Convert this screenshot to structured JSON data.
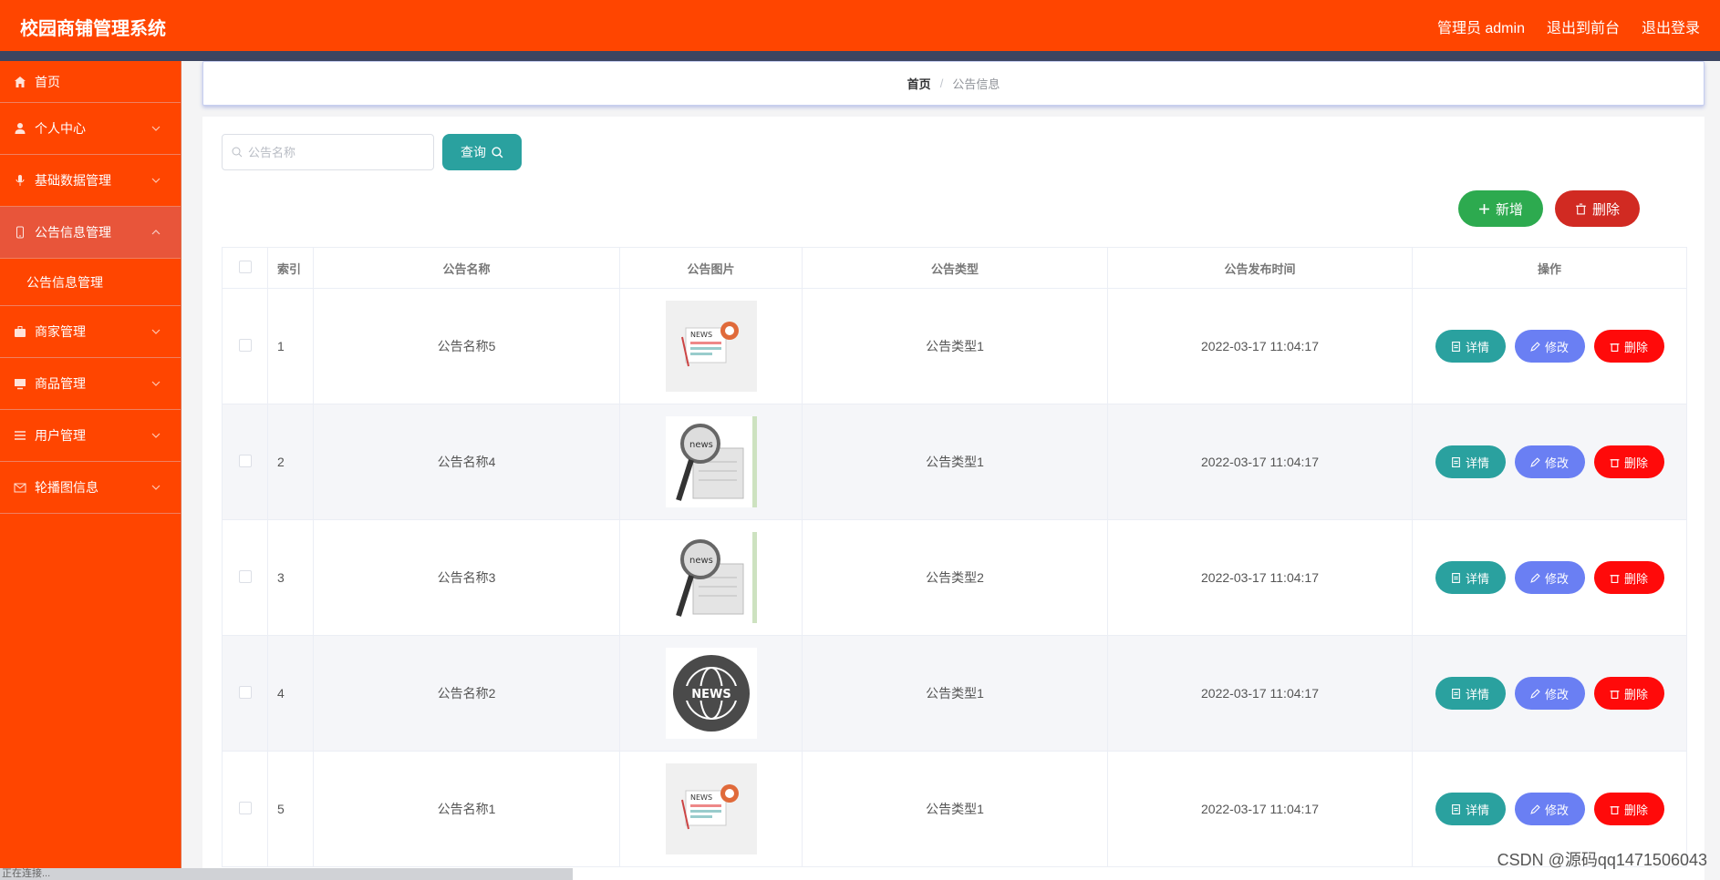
{
  "header": {
    "title": "校园商铺管理系统",
    "admin_label": "管理员 admin",
    "to_front": "退出到前台",
    "logout": "退出登录"
  },
  "sidebar": {
    "items": [
      {
        "label": "首页",
        "icon": "home-icon"
      },
      {
        "label": "个人中心",
        "icon": "user-icon"
      },
      {
        "label": "基础数据管理",
        "icon": "microphone-icon"
      },
      {
        "label": "公告信息管理",
        "icon": "phone-icon"
      },
      {
        "label": "商家管理",
        "icon": "briefcase-icon"
      },
      {
        "label": "商品管理",
        "icon": "monitor-icon"
      },
      {
        "label": "用户管理",
        "icon": "list-icon"
      },
      {
        "label": "轮播图信息",
        "icon": "mail-icon"
      }
    ],
    "submenu_label": "公告信息管理"
  },
  "breadcrumb": {
    "home": "首页",
    "separator": "/",
    "current": "公告信息"
  },
  "search": {
    "placeholder": "公告名称",
    "query_label": "查询"
  },
  "actions": {
    "add_label": "新增",
    "delete_label": "删除"
  },
  "table": {
    "headers": [
      "索引",
      "公告名称",
      "公告图片",
      "公告类型",
      "公告发布时间",
      "操作"
    ],
    "rows": [
      {
        "index": "1",
        "name": "公告名称5",
        "image": "news-desk-image",
        "type": "公告类型1",
        "time": "2022-03-17 11:04:17"
      },
      {
        "index": "2",
        "name": "公告名称4",
        "image": "news-magnifier-image",
        "type": "公告类型1",
        "time": "2022-03-17 11:04:17"
      },
      {
        "index": "3",
        "name": "公告名称3",
        "image": "news-magnifier-image",
        "type": "公告类型2",
        "time": "2022-03-17 11:04:17"
      },
      {
        "index": "4",
        "name": "公告名称2",
        "image": "news-globe-image",
        "type": "公告类型1",
        "time": "2022-03-17 11:04:17"
      },
      {
        "index": "5",
        "name": "公告名称1",
        "image": "news-desk-image",
        "type": "公告类型1",
        "time": "2022-03-17 11:04:17"
      }
    ],
    "op_labels": {
      "detail": "详情",
      "edit": "修改",
      "remove": "删除"
    }
  },
  "watermark": "CSDN @源码qq1471506043",
  "statusbar": "正在连接..."
}
